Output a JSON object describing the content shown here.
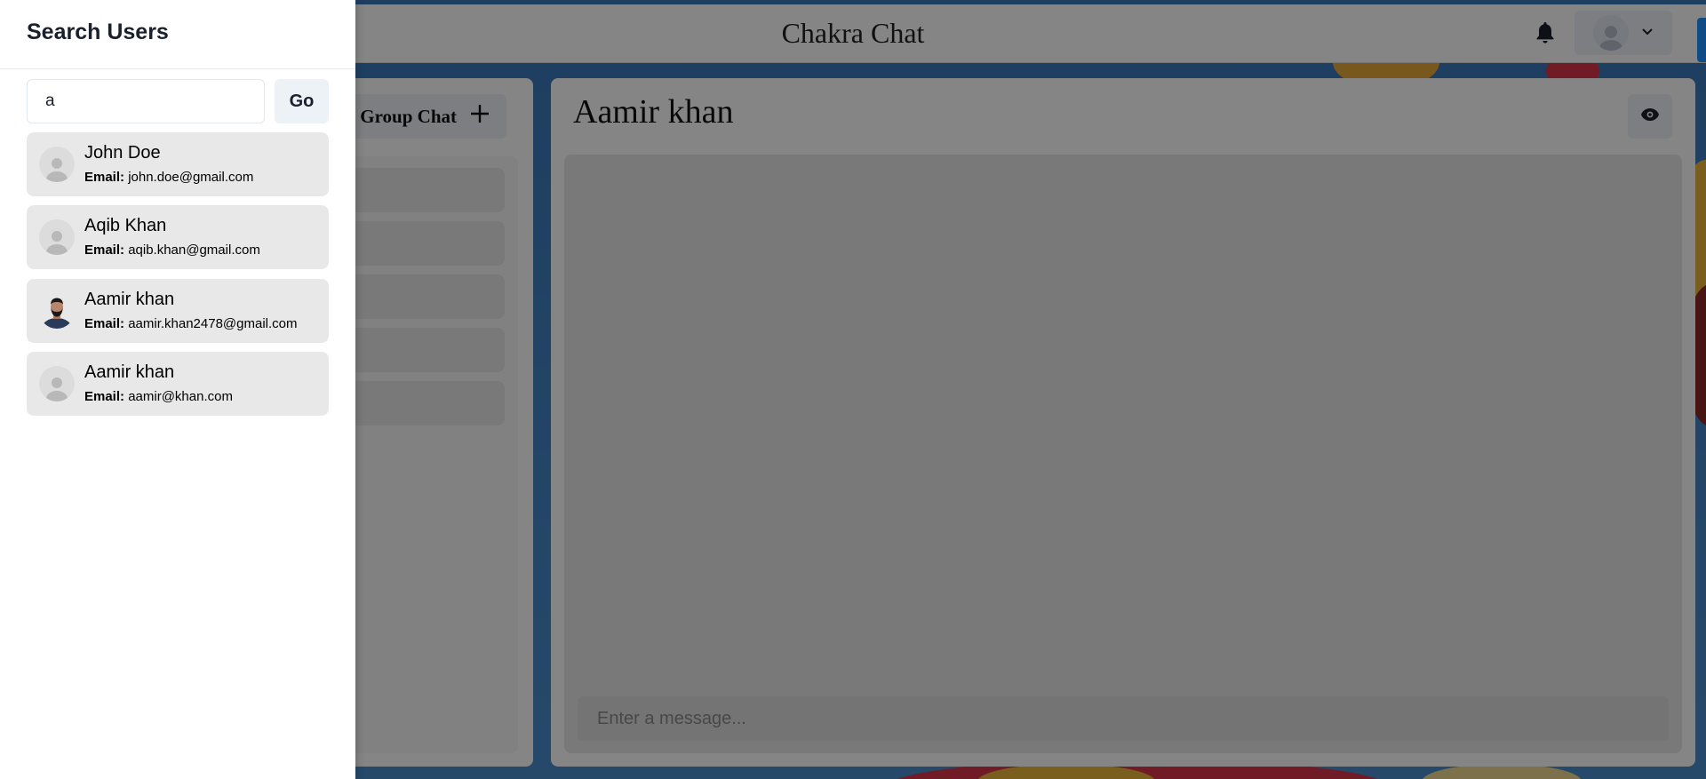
{
  "header": {
    "title": "Chakra Chat"
  },
  "chats": {
    "new_group_label": "New Group Chat"
  },
  "chat": {
    "name": "Aamir khan",
    "message_placeholder": "Enter a message..."
  },
  "drawer": {
    "title": "Search Users",
    "search_value": "a",
    "go_label": "Go",
    "email_label": "Email:",
    "users": [
      {
        "name": "John Doe",
        "email": "john.doe@gmail.com",
        "avatar": "default-avatar"
      },
      {
        "name": "Aqib Khan",
        "email": "aqib.khan@gmail.com",
        "avatar": "default-avatar"
      },
      {
        "name": "Aamir khan",
        "email": "aamir.khan2478@gmail.com",
        "avatar": "photo-avatar"
      },
      {
        "name": "Aamir khan",
        "email": "aamir@khan.com",
        "avatar": "default-avatar"
      }
    ]
  },
  "colors": {
    "accent": "#1e90ff",
    "overlay": "#000000"
  }
}
